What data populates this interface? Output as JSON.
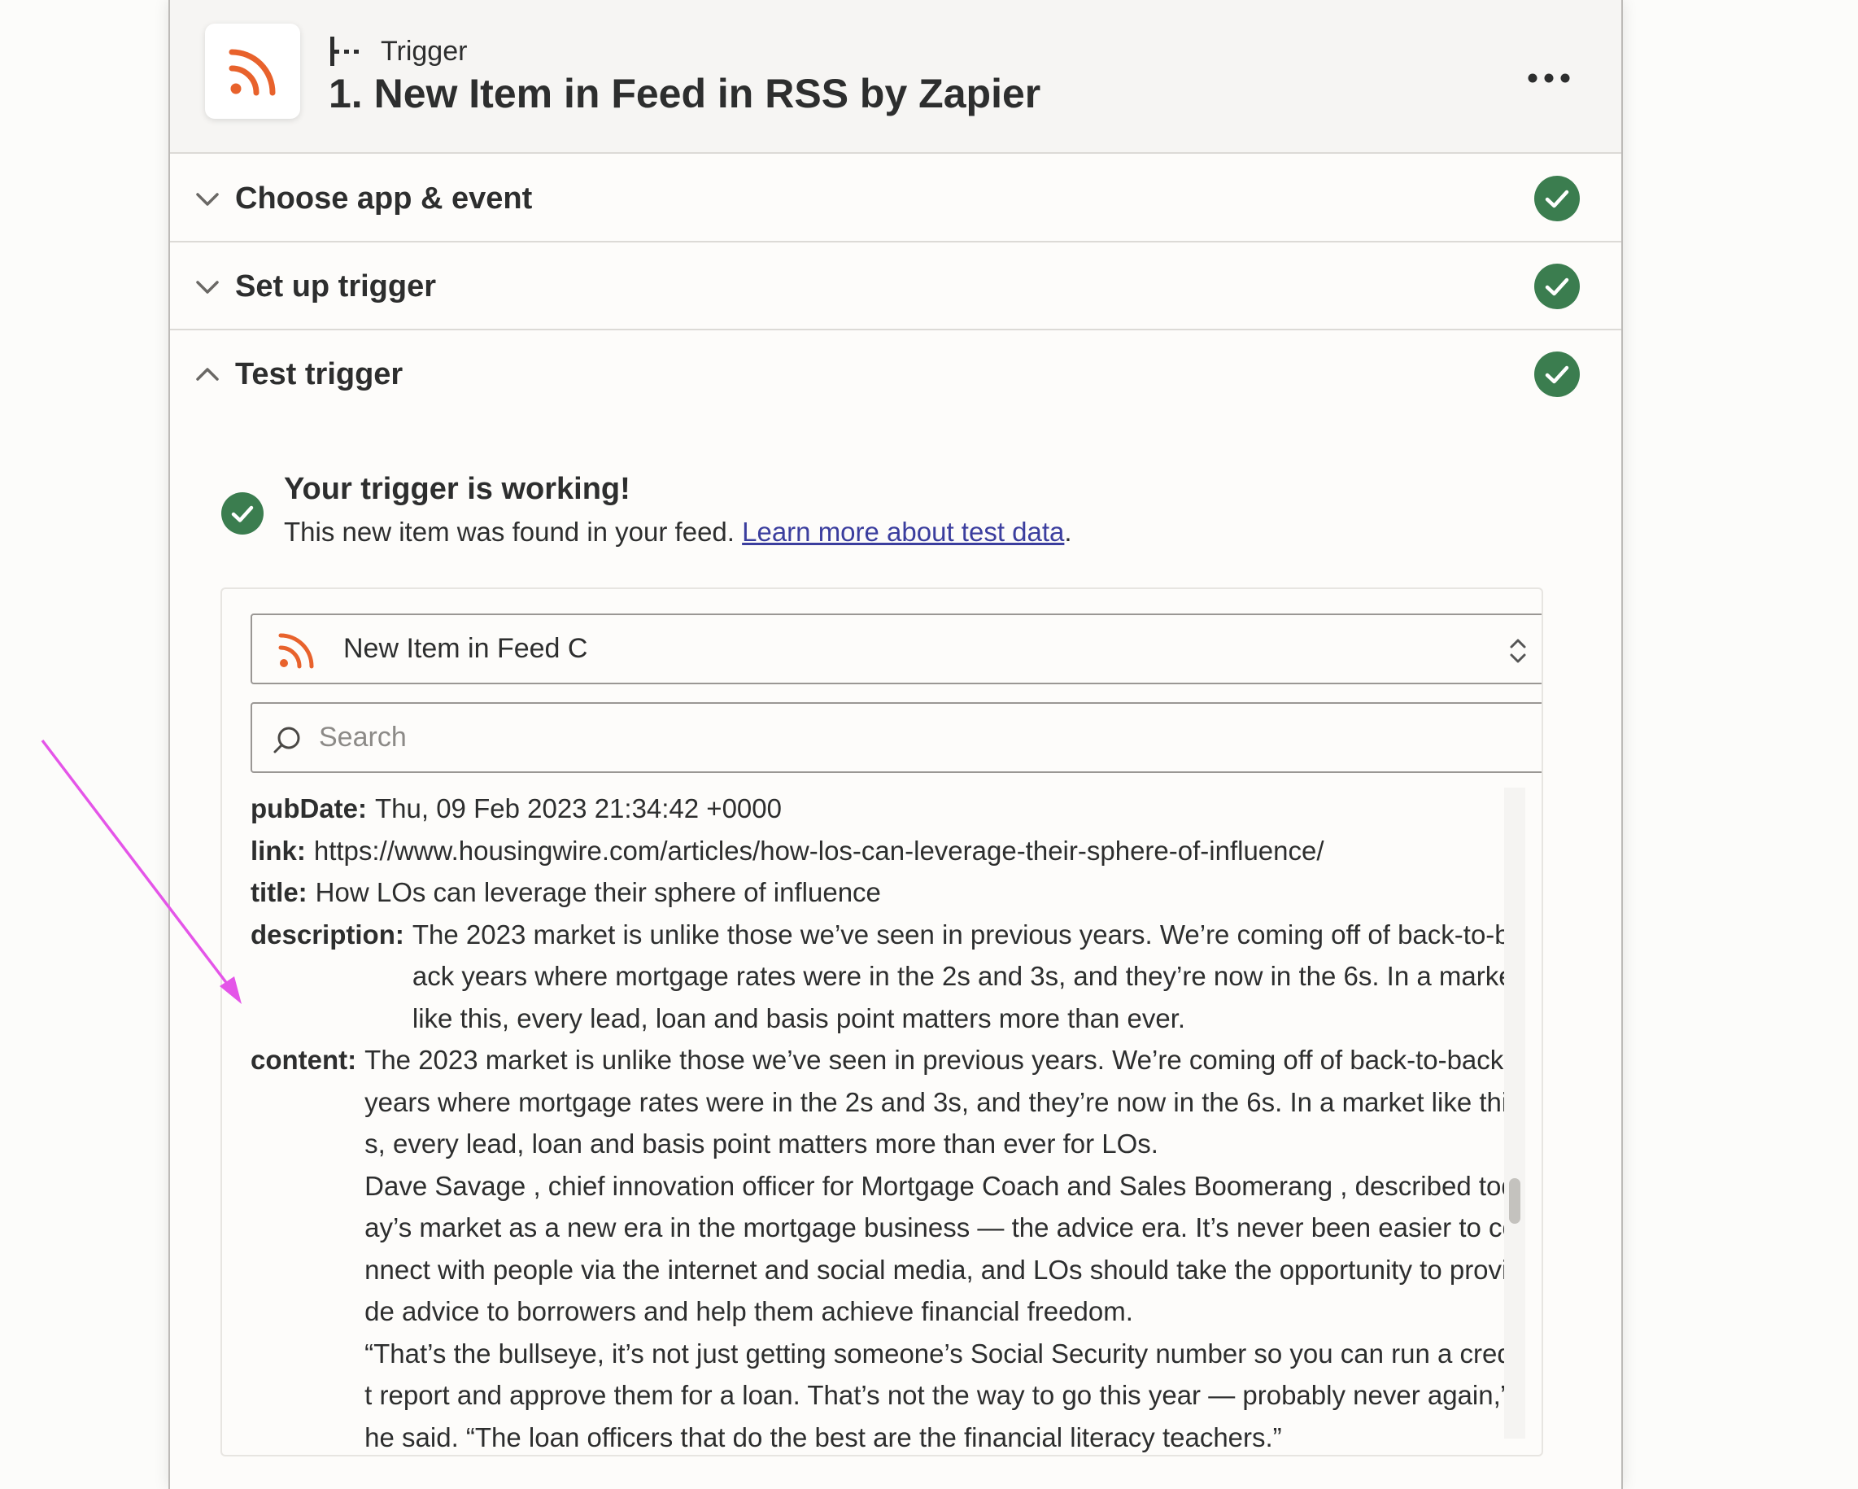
{
  "header": {
    "app_icon": "rss-icon",
    "trigger_type_label": "Trigger",
    "step_title": "1. New Item in Feed in RSS by Zapier",
    "more_icon": "more-horizontal-icon"
  },
  "sections": {
    "choose": {
      "label": "Choose app & event",
      "expanded": false,
      "status": "complete"
    },
    "setup": {
      "label": "Set up trigger",
      "expanded": false,
      "status": "complete"
    },
    "test": {
      "label": "Test trigger",
      "expanded": true,
      "status": "complete"
    }
  },
  "test_result": {
    "title": "Your trigger is working!",
    "description": "This new item was found in your feed.",
    "link_text": "Learn more about test data",
    "period": "."
  },
  "item_select": {
    "selected": "New Item in Feed C",
    "icon": "rss-icon"
  },
  "search": {
    "placeholder": "Search",
    "value": ""
  },
  "fields": {
    "pubDate": {
      "key": "pubDate:",
      "value": "Thu, 09 Feb 2023 21:34:42 +0000"
    },
    "link": {
      "key": "link:",
      "value": "https://www.housingwire.com/articles/how-los-can-leverage-their-sphere-of-influence/"
    },
    "title": {
      "key": "title:",
      "value": "How LOs can leverage their sphere of influence"
    },
    "description": {
      "key": "description:",
      "value": "The 2023 market is unlike those we’ve seen in previous years. We’re coming off of back-to-back years where mortgage rates were in the 2s and 3s, and they’re now in the 6s. In a market like this, every lead, loan and basis point matters more than ever."
    },
    "content": {
      "key": "content:",
      "paragraphs": [
        "The 2023 market is unlike those we’ve seen in previous years. We’re coming off of back-to-back years where mortgage rates were in the 2s and 3s, and they’re now in the 6s. In a market like this, every lead, loan and basis point matters more than ever for LOs.",
        "Dave Savage , chief innovation officer for Mortgage Coach and Sales Boomerang , described today’s market as a new era in the mortgage business — the advice era. It’s never been easier to connect with people via the internet and social media, and LOs should take the opportunity to provide advice to borrowers and help them achieve financial freedom.",
        "“That’s the bullseye, it’s not just getting someone’s Social Security number so you can run a credit report and approve them for a loan. That’s not the way to go this year — probably never again,” he said. “The loan officers that do the best are the financial literacy teachers.”"
      ]
    }
  },
  "colors": {
    "rss_orange": "#e8622c",
    "success_green": "#3b7d4f",
    "link_blue": "#3b3e9e",
    "annotation_magenta": "#e455e8"
  }
}
